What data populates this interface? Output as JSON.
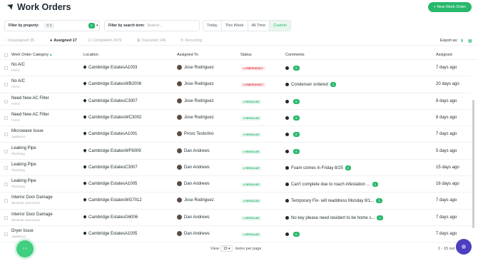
{
  "header": {
    "title": "Work Orders",
    "new_button": "+ New Work Order"
  },
  "filters": {
    "property_label": "Filter by property:",
    "property_chip": "✕ 0",
    "property_count": "1",
    "search_label": "Filter by search term:",
    "search_placeholder": "Search...",
    "time_options": [
      "Today",
      "This Week",
      "All Time",
      "Custom"
    ],
    "time_selected": "Custom"
  },
  "tabs": [
    {
      "label": "Unassigned 35",
      "active": false
    },
    {
      "label": "Assigned 17",
      "active": true
    },
    {
      "label": "Completed 2479",
      "active": false
    },
    {
      "label": "Canceled 146",
      "active": false
    },
    {
      "label": "Recurring",
      "active": false
    }
  ],
  "export_label": "Export as:",
  "columns": [
    "Work Order Category",
    "Location",
    "Assigned To",
    "Status",
    "Comments",
    "Assigned"
  ],
  "rows": [
    {
      "category": "No A/C",
      "sub": "HVAC",
      "loc_name": "Cambridge Estates",
      "loc_unit": "A1003",
      "person": "Jose Rodriguez",
      "status": "EMERGENCY",
      "status_type": "em",
      "comment": "",
      "count": "0",
      "ago": "7 days ago"
    },
    {
      "category": "No A/C",
      "sub": "HVAC",
      "loc_name": "Cambridge Estates",
      "loc_unit": "WB2008",
      "person": "Jose Rodriguez",
      "status": "EMERGENCY",
      "status_type": "em",
      "comment": "Condenser ordered",
      "count": "1",
      "ago": "20 days ago"
    },
    {
      "category": "Need New AC Filter",
      "sub": "HVAC",
      "loc_name": "Cambridge Estates",
      "loc_unit": "C3007",
      "person": "Jose Rodriguez",
      "status": "REGULAR",
      "status_type": "rg",
      "comment": "",
      "count": "0",
      "ago": "8 days ago"
    },
    {
      "category": "Need New AC Filter",
      "sub": "HVAC",
      "loc_name": "Cambridge Estates",
      "loc_unit": "WC3002",
      "person": "Jose Rodriguez",
      "status": "REGULAR",
      "status_type": "rg",
      "comment": "",
      "count": "0",
      "ago": "8 days ago"
    },
    {
      "category": "Microwave Issue",
      "sub": "Appliance",
      "loc_name": "Cambridge Estates",
      "loc_unit": "A1001",
      "person": "Provo Testorino",
      "status": "REGULAR",
      "status_type": "rg",
      "comment": "",
      "count": "0",
      "ago": "7 days ago"
    },
    {
      "category": "Leaking Pipe",
      "sub": "Plumbing",
      "loc_name": "Cambridge Estates",
      "loc_unit": "WF6009",
      "person": "Dan Andrews",
      "status": "REGULAR",
      "status_type": "rg",
      "comment": "",
      "count": "0",
      "ago": "5 days ago"
    },
    {
      "category": "Leaking Pipe",
      "sub": "Plumbing",
      "loc_name": "Cambridge Estates",
      "loc_unit": "C3007",
      "person": "Dan Andrews",
      "status": "REGULAR",
      "status_type": "rg",
      "comment": "Foam comes in Friday 8/25",
      "count": "2",
      "ago": "15 days ago"
    },
    {
      "category": "Leaking Pipe",
      "sub": "Plumbing",
      "loc_name": "Cambridge Estates",
      "loc_unit": "A1005",
      "person": "Dan Andrews",
      "status": "REGULAR",
      "status_type": "rg",
      "comment": "Can't complete due to roach infestation ...",
      "count": "1",
      "ago": "16 days ago"
    },
    {
      "category": "Interior Door Damage",
      "sub": "Windows and Doors",
      "loc_name": "Cambridge Estates",
      "loc_unit": "WG7012",
      "person": "Jose Rodriguez",
      "status": "REGULAR",
      "status_type": "rg",
      "comment": "Temporary Fix- will readdress Monday 8/1...",
      "count": "1",
      "ago": "7 days ago"
    },
    {
      "category": "Interior Door Damage",
      "sub": "Windows and Doors",
      "loc_name": "Cambridge Estates",
      "loc_unit": "G6006",
      "person": "Dan Andrews",
      "status": "REGULAR",
      "status_type": "rg",
      "comment": "No key please need resident to be home s...",
      "count": "1",
      "ago": "7 days ago"
    },
    {
      "category": "Dryer Issue",
      "sub": "Appliance",
      "loc_name": "Cambridge Estates",
      "loc_unit": "A1005",
      "person": "Dan Andrews",
      "status": "REGULAR",
      "status_type": "rg",
      "comment": "",
      "count": "0",
      "ago": "7 days ago"
    }
  ],
  "footer": {
    "view_label": "View",
    "per_page": "15",
    "items_label": "items per page",
    "range": "1 - 15 out ..."
  },
  "colors": {
    "accent": "#27b86b",
    "emergency": "#d9434c",
    "chat": "#4b3fbf"
  }
}
